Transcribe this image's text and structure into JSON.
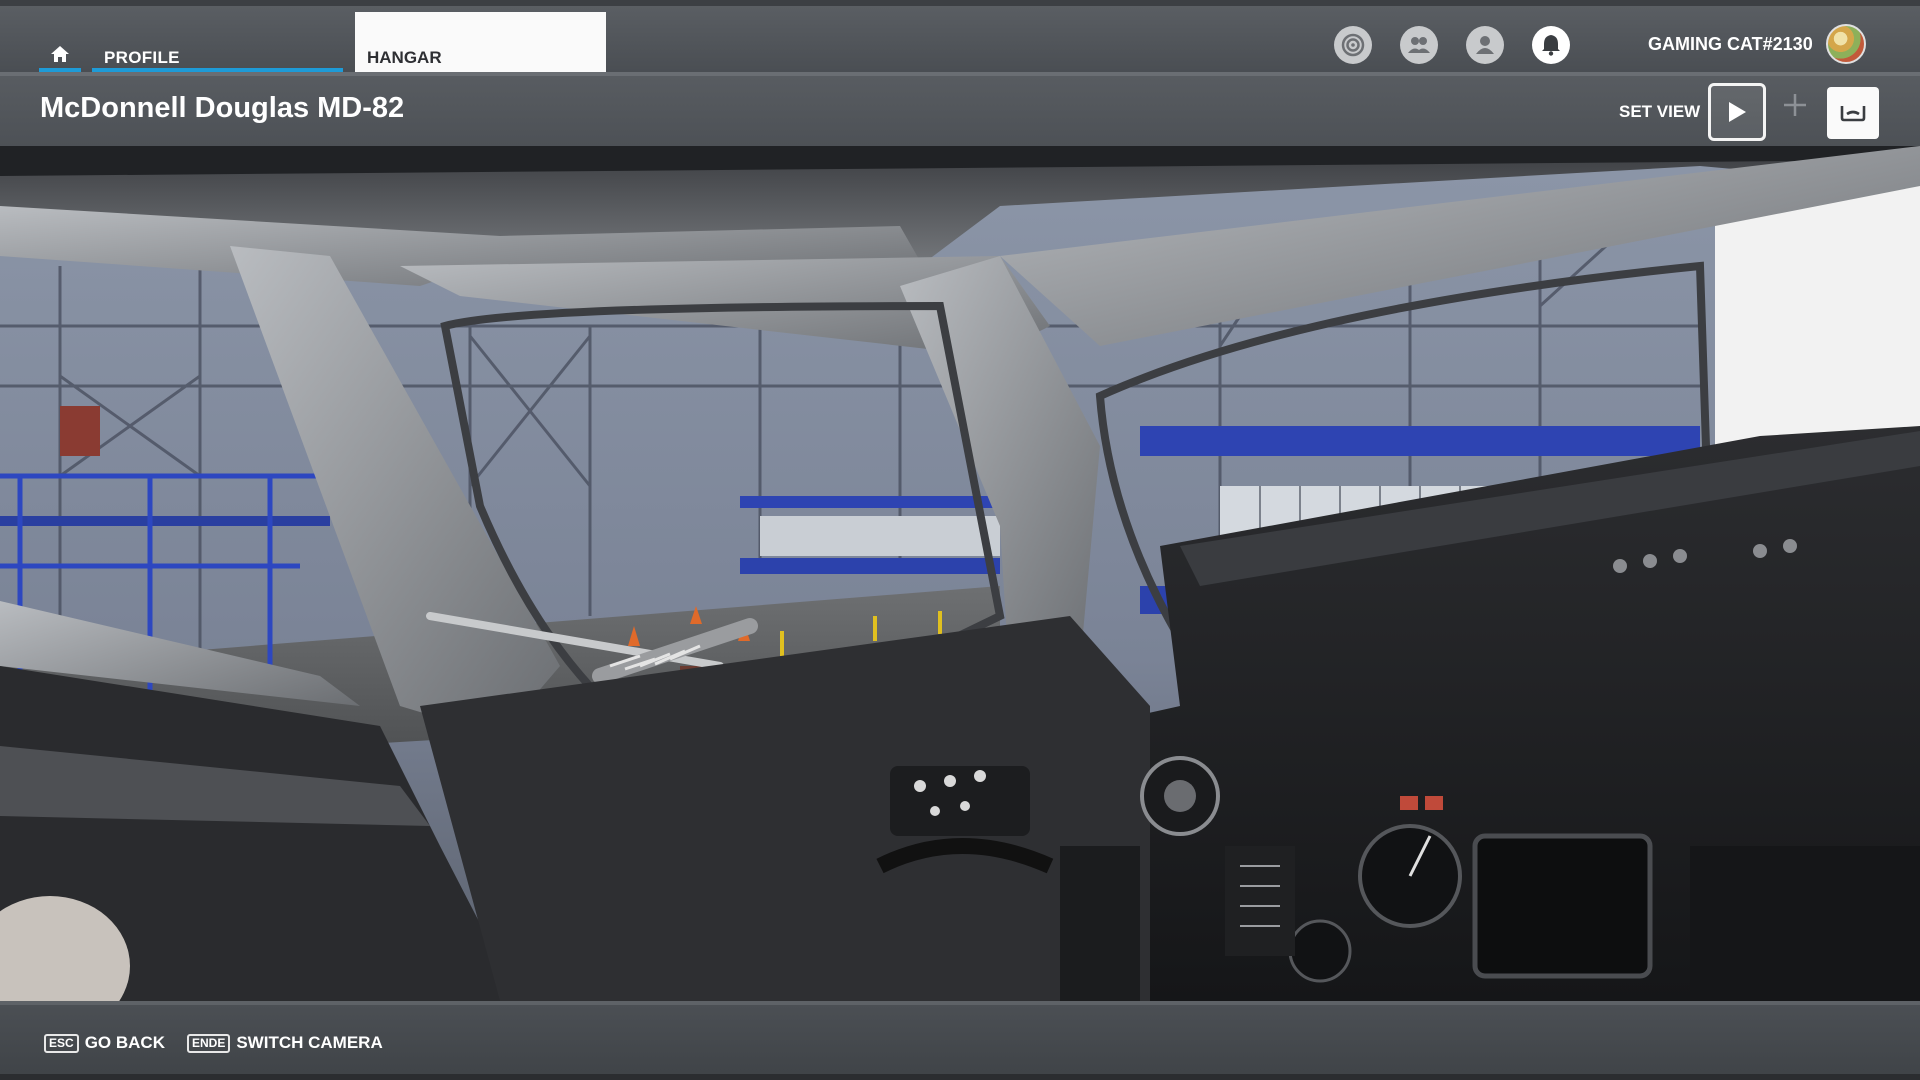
{
  "nav": {
    "tabs": [
      {
        "label": "PROFILE",
        "active": true
      },
      {
        "label": "HANGAR",
        "active": false
      }
    ],
    "icons": [
      "achievements-icon",
      "friends-icon",
      "profile-icon",
      "notifications-icon"
    ],
    "username": "GAMING CAT#2130"
  },
  "header": {
    "aircraft_name": "McDonnell Douglas MD-82",
    "set_view_label": "SET VIEW"
  },
  "footer": {
    "hints": [
      {
        "key": "ESC",
        "label": "GO BACK"
      },
      {
        "key": "ENDE",
        "label": "SWITCH CAMERA"
      }
    ]
  },
  "colors": {
    "accent": "#1e9bd7",
    "bar": "#4d5156",
    "active_tab_bg": "#fafafa"
  }
}
